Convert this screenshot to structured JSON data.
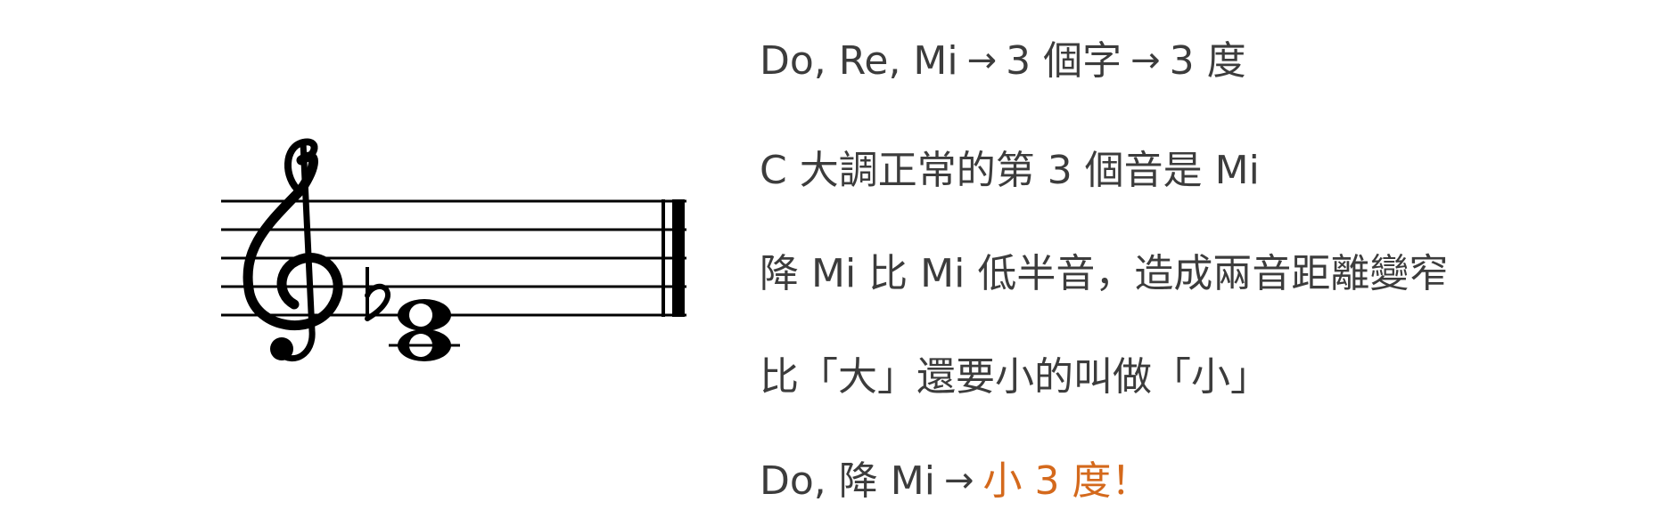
{
  "colors": {
    "text": "#3c3c3c",
    "accent": "#d4691c",
    "staff": "#000000",
    "background": "#ffffff"
  },
  "score": {
    "icons": [
      "treble-clef-icon",
      "flat-sign-icon",
      "whole-note-icon",
      "final-barline-icon"
    ]
  },
  "lines": [
    {
      "part1": "Do, Re, Mi",
      "arrow1": "→",
      "part2": "3 個字",
      "arrow2": "→",
      "part3": "3 度"
    },
    {
      "text": "C 大調正常的第 3 個音是 Mi"
    },
    {
      "text": "降 Mi 比 Mi 低半音，造成兩音距離變窄"
    },
    {
      "text": "比「大」還要小的叫做「小」"
    },
    {
      "part1": "Do, 降 Mi",
      "arrow": "→",
      "highlight": "小 3 度！"
    }
  ]
}
